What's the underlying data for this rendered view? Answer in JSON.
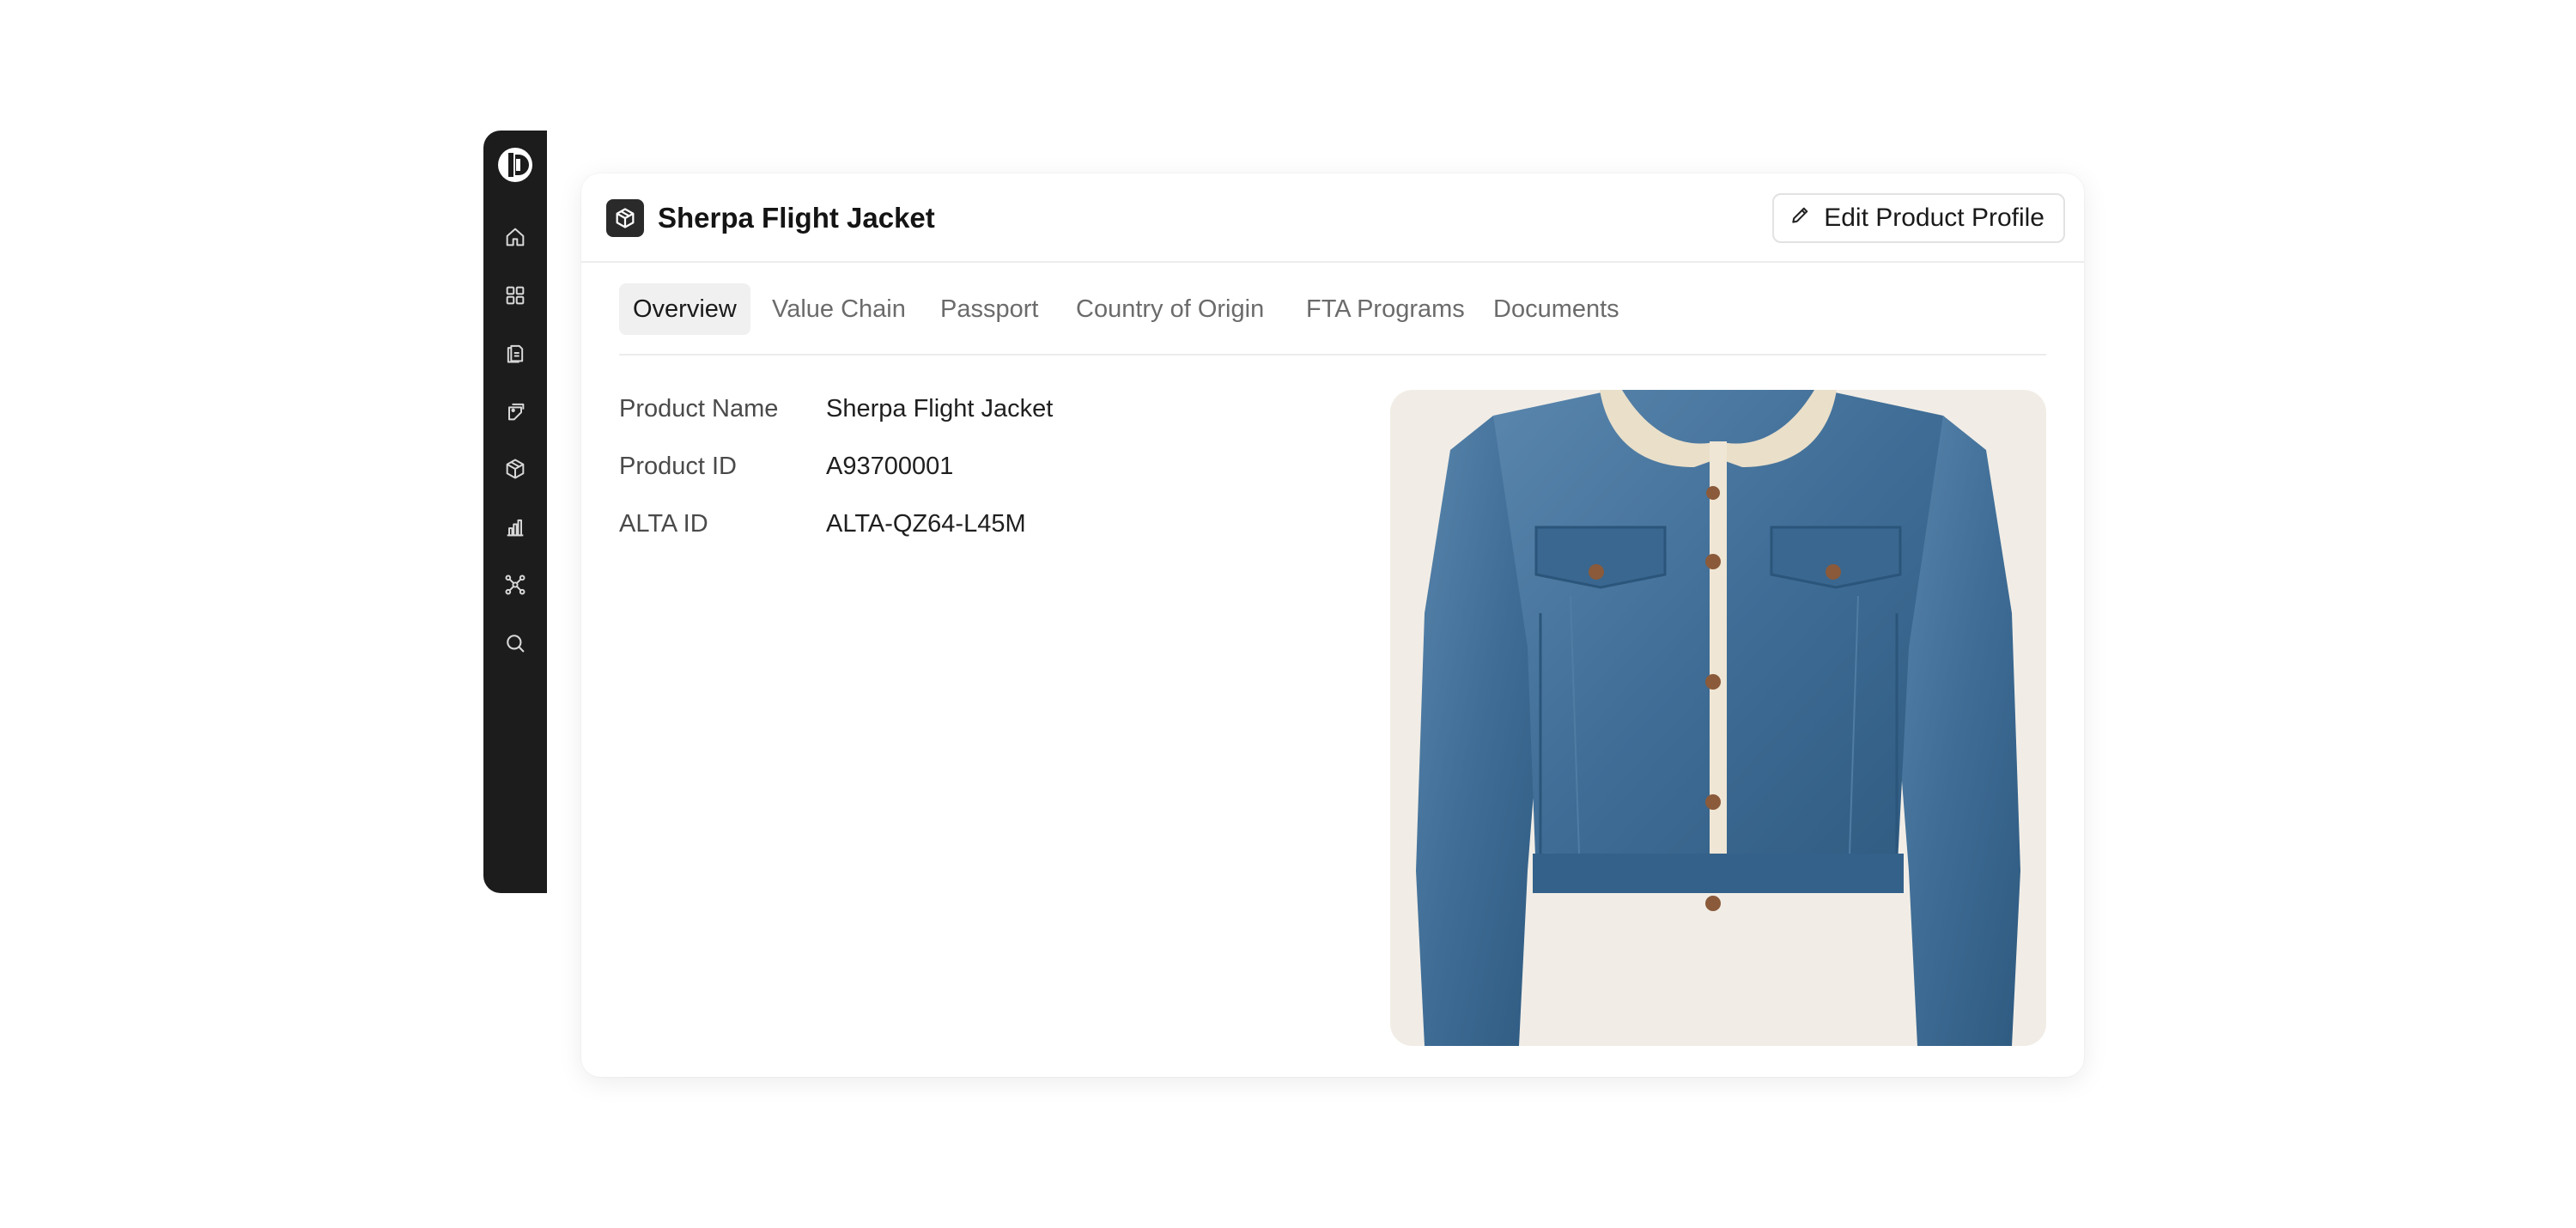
{
  "app": {
    "logo_icon": "brand-logo-icon",
    "nav": [
      {
        "icon": "home-icon"
      },
      {
        "icon": "grid-icon"
      },
      {
        "icon": "documents-icon"
      },
      {
        "icon": "tags-icon"
      },
      {
        "icon": "package-icon"
      },
      {
        "icon": "bar-chart-icon"
      },
      {
        "icon": "network-icon"
      },
      {
        "icon": "search-icon"
      }
    ]
  },
  "product": {
    "icon": "package-icon",
    "title": "Sherpa Flight Jacket",
    "edit_label": "Edit Product Profile"
  },
  "tabs": [
    {
      "label": "Overview",
      "active": true
    },
    {
      "label": "Value Chain",
      "active": false
    },
    {
      "label": "Passport",
      "active": false
    },
    {
      "label": "Country of Origin",
      "active": false
    },
    {
      "label": "FTA Programs",
      "active": false
    },
    {
      "label": "Documents",
      "active": false
    }
  ],
  "fields": [
    {
      "label": "Product Name",
      "value": "Sherpa Flight Jacket"
    },
    {
      "label": "Product ID",
      "value": "A93700001"
    },
    {
      "label": "ALTA ID",
      "value": "ALTA-QZ64-L45M"
    }
  ],
  "colors": {
    "sidebar_bg": "#1c1c1c",
    "active_tab_bg": "#f0f0f0",
    "photo_bg": "#f1ede6",
    "denim": "#3f6d96"
  }
}
